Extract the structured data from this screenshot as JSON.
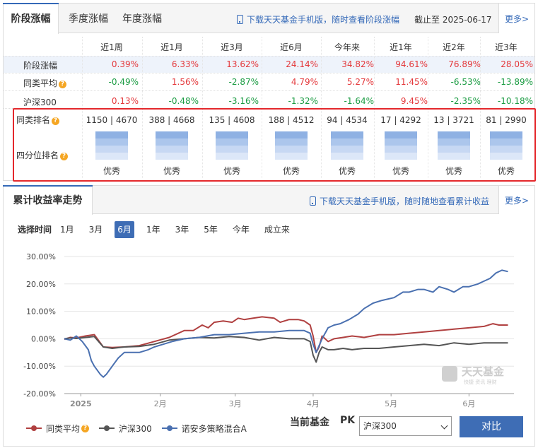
{
  "tabs": [
    "阶段涨幅",
    "季度涨幅",
    "年度涨幅"
  ],
  "download1": "下载天天基金手机版，随时查看阶段涨幅",
  "as_of": "截止至  2025-06-17",
  "more": "更多>",
  "periods": [
    "近1周",
    "近1月",
    "近3月",
    "近6月",
    "今年来",
    "近1年",
    "近2年",
    "近3年"
  ],
  "rows": {
    "stage": {
      "label": "阶段涨幅",
      "values": [
        "0.39%",
        "6.33%",
        "13.62%",
        "24.14%",
        "34.82%",
        "94.61%",
        "76.89%",
        "28.05%"
      ]
    },
    "peer": {
      "label": "同类平均",
      "values": [
        "-0.49%",
        "1.56%",
        "-2.87%",
        "4.79%",
        "5.27%",
        "11.45%",
        "-6.53%",
        "-13.89%"
      ]
    },
    "hs300": {
      "label": "沪深300",
      "values": [
        "0.13%",
        "-0.48%",
        "-3.16%",
        "-1.32%",
        "-1.64%",
        "9.45%",
        "-2.35%",
        "-10.18%"
      ]
    },
    "rank": {
      "label": "同类排名",
      "values": [
        "1150 | 4670",
        "388 | 4668",
        "135 | 4608",
        "188 | 4512",
        "94 | 4534",
        "17 | 4292",
        "13 | 3721",
        "81 | 2990"
      ]
    },
    "quartile": {
      "label": "四分位排名",
      "values": [
        "优秀",
        "优秀",
        "优秀",
        "优秀",
        "优秀",
        "优秀",
        "优秀",
        "优秀"
      ],
      "levels": [
        4,
        4,
        4,
        4,
        4,
        4,
        4,
        4
      ]
    }
  },
  "chart_section": {
    "title": "累计收益率走势",
    "download": "下载天天基金手机版，随时随地查看累计收益",
    "more": "更多>",
    "select_label": "选择时间",
    "ranges": [
      "1月",
      "3月",
      "6月",
      "1年",
      "3年",
      "5年",
      "今年",
      "成立来"
    ],
    "active_range": "6月",
    "watermark": {
      "brand": "天天基金",
      "sub": "快捷 资讯 理财"
    },
    "pk_label": "当前基金",
    "pk": "PK",
    "pk_value": "沪深300",
    "compare_button": "对比"
  },
  "chart_data": {
    "type": "line",
    "y_ticks": [
      "30.00%",
      "20.00%",
      "10.00%",
      "0.00%",
      "-10.00%",
      "-20.00%"
    ],
    "y_range": [
      -20,
      30
    ],
    "x_ticks": [
      "2025",
      "2月",
      "3月",
      "4月",
      "5月",
      "6月"
    ],
    "x_tick_pos": [
      5.5,
      32,
      57,
      83,
      109,
      135
    ],
    "x_range": [
      0,
      150
    ],
    "series": [
      {
        "name": "同类平均",
        "color": "#b04040",
        "x": [
          0,
          2,
          4,
          7,
          10,
          13,
          16,
          20,
          25,
          30,
          35,
          40,
          43,
          46,
          48,
          50,
          53,
          56,
          58,
          60,
          63,
          66,
          70,
          72,
          75,
          78,
          80,
          82,
          83,
          84,
          85,
          86,
          88,
          90,
          93,
          96,
          100,
          105,
          110,
          115,
          120,
          125,
          130,
          135,
          140,
          143,
          145,
          148
        ],
        "y": [
          -0.2,
          0.5,
          0.3,
          1,
          1.5,
          -3,
          -3.2,
          -3,
          -2.5,
          -1,
          0.5,
          3,
          3,
          5,
          4,
          6,
          6.5,
          6,
          7.5,
          7,
          7.5,
          8,
          7.5,
          6,
          7,
          7,
          6.5,
          5,
          1,
          -5,
          -3,
          1,
          -1,
          0,
          0.5,
          1,
          0.5,
          1.5,
          1.5,
          2,
          2.5,
          3,
          3.5,
          4,
          4.5,
          5.5,
          5,
          5
        ]
      },
      {
        "name": "沪深300",
        "color": "#555555",
        "x": [
          0,
          2,
          4,
          7,
          10,
          13,
          16,
          20,
          25,
          30,
          35,
          40,
          45,
          50,
          55,
          60,
          65,
          70,
          75,
          80,
          82,
          83,
          84,
          85,
          86,
          88,
          90,
          93,
          96,
          100,
          105,
          110,
          115,
          120,
          125,
          130,
          135,
          140,
          145,
          148
        ],
        "y": [
          0,
          0.3,
          0.1,
          0.5,
          0.8,
          -3,
          -3.5,
          -3,
          -2.8,
          -2,
          -0.5,
          0,
          0.5,
          0.3,
          0.8,
          0.5,
          -0.5,
          0.5,
          0,
          0,
          -1,
          -6,
          -8.5,
          -5,
          -3,
          -4,
          -4,
          -3.5,
          -4,
          -3.5,
          -3.5,
          -3,
          -2.5,
          -2,
          -2.5,
          -1.5,
          -2,
          -1.5,
          -1.5,
          -1.5
        ]
      },
      {
        "name": "诺安多策略混合A",
        "color": "#4a70b0",
        "x": [
          0,
          2,
          4,
          6,
          8,
          9,
          10,
          12,
          13,
          14,
          16,
          18,
          20,
          22,
          25,
          28,
          30,
          33,
          36,
          40,
          45,
          50,
          55,
          60,
          65,
          70,
          75,
          80,
          82,
          83,
          84,
          86,
          88,
          90,
          92,
          95,
          98,
          100,
          103,
          106,
          110,
          113,
          115,
          118,
          120,
          123,
          125,
          128,
          130,
          133,
          135,
          138,
          140,
          142,
          144,
          146,
          148
        ],
        "y": [
          0,
          -0.5,
          1,
          -1,
          -4,
          -8,
          -10,
          -13,
          -14,
          -13,
          -10,
          -7,
          -5,
          -5,
          -5,
          -4,
          -3,
          -2,
          -1,
          0,
          0.5,
          1.5,
          1.5,
          2,
          2.5,
          2.5,
          3,
          3,
          2,
          -2,
          -5,
          0,
          4,
          5,
          5.5,
          7,
          9,
          11,
          13,
          14,
          15,
          17,
          17,
          18,
          18,
          17,
          19,
          18,
          17,
          19,
          19,
          20,
          21,
          22,
          24,
          25,
          24.5
        ]
      }
    ]
  }
}
